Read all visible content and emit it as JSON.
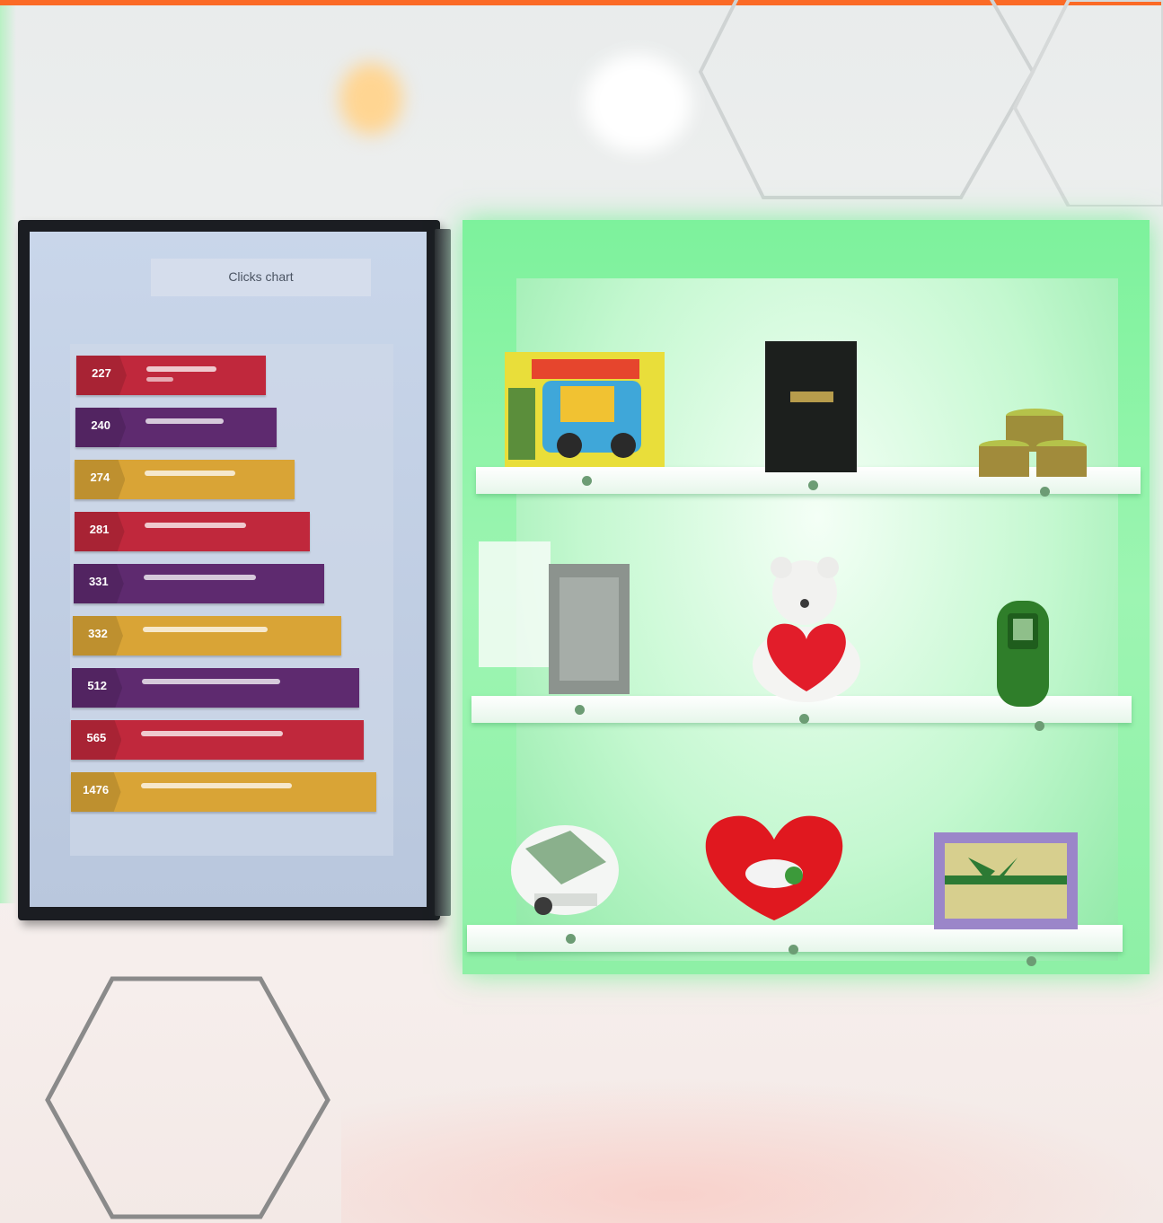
{
  "screen": {
    "chart_title": "Clicks chart",
    "bars": [
      {
        "value": "227",
        "color": "#c0283c",
        "fill": 0.62
      },
      {
        "value": "240",
        "color": "#5e2a6f",
        "fill": 0.66
      },
      {
        "value": "274",
        "color": "#d9a436",
        "fill": 0.72
      },
      {
        "value": "281",
        "color": "#c0283c",
        "fill": 0.77
      },
      {
        "value": "331",
        "color": "#5e2a6f",
        "fill": 0.82
      },
      {
        "value": "332",
        "color": "#d9a436",
        "fill": 0.88
      },
      {
        "value": "512",
        "color": "#5e2a6f",
        "fill": 0.94
      },
      {
        "value": "565",
        "color": "#c0283c",
        "fill": 0.96
      },
      {
        "value": "1476",
        "color": "#d9a436",
        "fill": 1.0
      }
    ]
  },
  "shelf": {
    "glow_color": "#7df29c",
    "items": [
      "toy-car-box",
      "black-book",
      "honey-jars",
      "greeting-card",
      "teddy-bear-with-heart",
      "green-phone",
      "toy-car",
      "heart-pillow",
      "gift-box"
    ]
  },
  "colors": {
    "accent_bar": "#fb6a26",
    "wall": "#eeefee"
  }
}
